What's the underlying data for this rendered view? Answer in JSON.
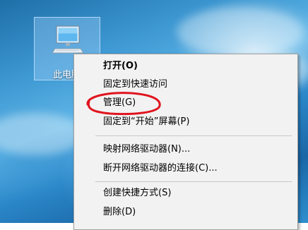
{
  "desktop": {
    "icon_label": "此电脑",
    "icon_name": "computer-icon"
  },
  "context_menu": {
    "items": [
      {
        "label": "打开(O)",
        "bold": true
      },
      {
        "label": "固定到快速访问"
      },
      {
        "label": "管理(G)"
      },
      {
        "label": "固定到“开始”屏幕(P)"
      },
      {
        "label": "映射网络驱动器(N)..."
      },
      {
        "label": "断开网络驱动器的连接(C)..."
      },
      {
        "label": "创建快捷方式(S)"
      },
      {
        "label": "删除(D)"
      }
    ]
  },
  "annotation": {
    "target": "管理(G)",
    "color": "#e0141e"
  }
}
